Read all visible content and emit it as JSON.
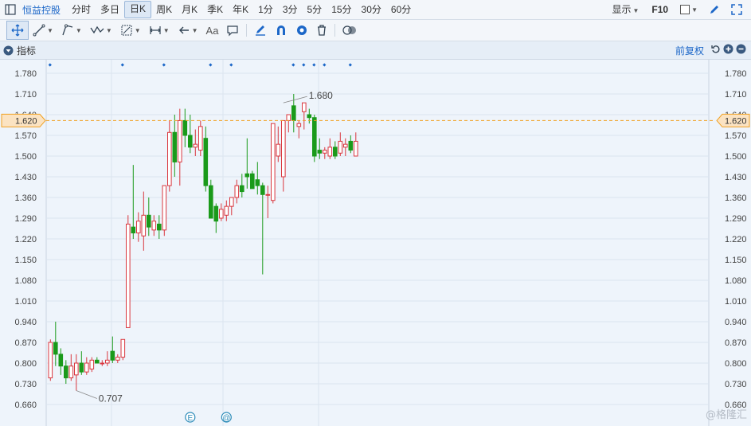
{
  "toolbar": {
    "stock_name": "恒益控股",
    "timeframes": [
      "分时",
      "多日",
      "日K",
      "周K",
      "月K",
      "季K",
      "年K",
      "1分",
      "3分",
      "5分",
      "15分",
      "30分",
      "60分"
    ],
    "active_timeframe": "日K",
    "display_label": "显示",
    "f10_label": "F10"
  },
  "drawing_tools": {
    "text_tool_label": "Aa"
  },
  "indicator_bar": {
    "label": "指标",
    "adjust_label": "前复权"
  },
  "watermark": "@格隆汇",
  "colors": {
    "up": "#d9363e",
    "down": "#1a9a1a",
    "accent": "#1c67c8",
    "current_price": "#f0a020",
    "grid": "#dbe4ef"
  },
  "chart_data": {
    "type": "candlestick",
    "y_ticks": [
      1.78,
      1.71,
      1.64,
      1.57,
      1.5,
      1.43,
      1.36,
      1.29,
      1.22,
      1.15,
      1.08,
      1.01,
      0.94,
      0.87,
      0.8,
      0.73,
      0.66
    ],
    "y_tick_labels": [
      "1.780",
      "1.710",
      "1.640",
      "1.570",
      "1.500",
      "1.430",
      "1.360",
      "1.290",
      "1.220",
      "1.150",
      "1.080",
      "1.010",
      "0.940",
      "0.870",
      "0.800",
      "0.730",
      "0.660"
    ],
    "ylim": [
      0.625,
      1.835
    ],
    "current_price": 1.62,
    "current_price_label": "1.620",
    "high_annotation": {
      "value": 1.68,
      "label": "1.680",
      "index": 45
    },
    "low_annotation": {
      "value": 0.707,
      "label": "0.707",
      "index": 5
    },
    "event_markers": [
      {
        "index": 27,
        "symbol": "E"
      },
      {
        "index": 34,
        "symbol": "@"
      }
    ],
    "candles": [
      {
        "o": 0.75,
        "h": 0.88,
        "l": 0.74,
        "c": 0.87
      },
      {
        "o": 0.87,
        "h": 0.94,
        "l": 0.79,
        "c": 0.83
      },
      {
        "o": 0.83,
        "h": 0.85,
        "l": 0.76,
        "c": 0.79
      },
      {
        "o": 0.79,
        "h": 0.81,
        "l": 0.73,
        "c": 0.75
      },
      {
        "o": 0.75,
        "h": 0.83,
        "l": 0.74,
        "c": 0.79
      },
      {
        "o": 0.76,
        "h": 0.83,
        "l": 0.707,
        "c": 0.8
      },
      {
        "o": 0.8,
        "h": 0.84,
        "l": 0.76,
        "c": 0.77
      },
      {
        "o": 0.77,
        "h": 0.82,
        "l": 0.76,
        "c": 0.8
      },
      {
        "o": 0.78,
        "h": 0.82,
        "l": 0.77,
        "c": 0.81
      },
      {
        "o": 0.81,
        "h": 0.82,
        "l": 0.8,
        "c": 0.8
      },
      {
        "o": 0.8,
        "h": 0.81,
        "l": 0.79,
        "c": 0.8
      },
      {
        "o": 0.8,
        "h": 0.84,
        "l": 0.79,
        "c": 0.81
      },
      {
        "o": 0.84,
        "h": 0.89,
        "l": 0.8,
        "c": 0.81
      },
      {
        "o": 0.81,
        "h": 0.83,
        "l": 0.8,
        "c": 0.82
      },
      {
        "o": 0.82,
        "h": 0.88,
        "l": 0.81,
        "c": 0.88
      },
      {
        "o": 0.92,
        "h": 1.3,
        "l": 0.92,
        "c": 1.27
      },
      {
        "o": 1.26,
        "h": 1.47,
        "l": 1.22,
        "c": 1.24
      },
      {
        "o": 1.24,
        "h": 1.31,
        "l": 1.21,
        "c": 1.28
      },
      {
        "o": 1.23,
        "h": 1.38,
        "l": 1.18,
        "c": 1.3
      },
      {
        "o": 1.3,
        "h": 1.36,
        "l": 1.23,
        "c": 1.26
      },
      {
        "o": 1.25,
        "h": 1.3,
        "l": 1.23,
        "c": 1.28
      },
      {
        "o": 1.27,
        "h": 1.3,
        "l": 1.22,
        "c": 1.25
      },
      {
        "o": 1.25,
        "h": 1.32,
        "l": 1.23,
        "c": 1.4
      },
      {
        "o": 1.4,
        "h": 1.62,
        "l": 1.38,
        "c": 1.58
      },
      {
        "o": 1.58,
        "h": 1.64,
        "l": 1.43,
        "c": 1.48
      },
      {
        "o": 1.48,
        "h": 1.66,
        "l": 1.4,
        "c": 1.62
      },
      {
        "o": 1.62,
        "h": 1.66,
        "l": 1.53,
        "c": 1.57
      },
      {
        "o": 1.57,
        "h": 1.64,
        "l": 1.51,
        "c": 1.53
      },
      {
        "o": 1.53,
        "h": 1.59,
        "l": 1.5,
        "c": 1.54
      },
      {
        "o": 1.52,
        "h": 1.62,
        "l": 1.5,
        "c": 1.6
      },
      {
        "o": 1.56,
        "h": 1.6,
        "l": 1.38,
        "c": 1.4
      },
      {
        "o": 1.4,
        "h": 1.42,
        "l": 1.3,
        "c": 1.29
      },
      {
        "o": 1.33,
        "h": 1.34,
        "l": 1.24,
        "c": 1.28
      },
      {
        "o": 1.29,
        "h": 1.34,
        "l": 1.28,
        "c": 1.32
      },
      {
        "o": 1.3,
        "h": 1.35,
        "l": 1.28,
        "c": 1.33
      },
      {
        "o": 1.33,
        "h": 1.36,
        "l": 1.3,
        "c": 1.36
      },
      {
        "o": 1.36,
        "h": 1.42,
        "l": 1.34,
        "c": 1.4
      },
      {
        "o": 1.4,
        "h": 1.44,
        "l": 1.36,
        "c": 1.38
      },
      {
        "o": 1.44,
        "h": 1.56,
        "l": 1.39,
        "c": 1.43
      },
      {
        "o": 1.44,
        "h": 1.45,
        "l": 1.39,
        "c": 1.39
      },
      {
        "o": 1.42,
        "h": 1.48,
        "l": 1.37,
        "c": 1.4
      },
      {
        "o": 1.4,
        "h": 1.41,
        "l": 1.1,
        "c": 1.37
      },
      {
        "o": 1.37,
        "h": 1.4,
        "l": 1.29,
        "c": 1.37
      },
      {
        "o": 1.35,
        "h": 1.52,
        "l": 1.34,
        "c": 1.61
      },
      {
        "o": 1.5,
        "h": 1.6,
        "l": 1.48,
        "c": 1.54
      },
      {
        "o": 1.43,
        "h": 1.6,
        "l": 1.38,
        "c": 1.62
      },
      {
        "o": 1.62,
        "h": 1.64,
        "l": 1.58,
        "c": 1.64
      },
      {
        "o": 1.67,
        "h": 1.71,
        "l": 1.58,
        "c": 1.62
      },
      {
        "o": 1.6,
        "h": 1.62,
        "l": 1.56,
        "c": 1.61
      },
      {
        "o": 1.65,
        "h": 1.68,
        "l": 1.59,
        "c": 1.68
      },
      {
        "o": 1.64,
        "h": 1.66,
        "l": 1.61,
        "c": 1.63
      },
      {
        "o": 1.63,
        "h": 1.64,
        "l": 1.48,
        "c": 1.5
      },
      {
        "o": 1.52,
        "h": 1.56,
        "l": 1.49,
        "c": 1.51
      },
      {
        "o": 1.51,
        "h": 1.53,
        "l": 1.49,
        "c": 1.52
      },
      {
        "o": 1.5,
        "h": 1.56,
        "l": 1.49,
        "c": 1.53
      },
      {
        "o": 1.53,
        "h": 1.55,
        "l": 1.49,
        "c": 1.5
      },
      {
        "o": 1.51,
        "h": 1.58,
        "l": 1.5,
        "c": 1.55
      },
      {
        "o": 1.53,
        "h": 1.56,
        "l": 1.5,
        "c": 1.54
      },
      {
        "o": 1.55,
        "h": 1.57,
        "l": 1.51,
        "c": 1.52
      },
      {
        "o": 1.5,
        "h": 1.58,
        "l": 1.5,
        "c": 1.55
      }
    ]
  }
}
